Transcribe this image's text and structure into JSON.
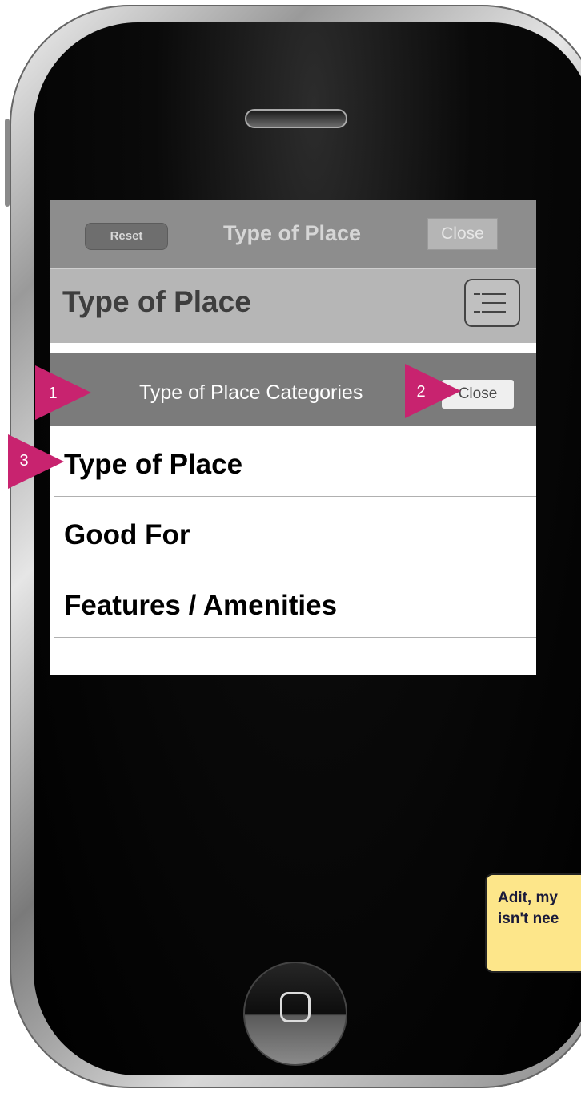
{
  "toolbar": {
    "reset_label": "Reset",
    "title": "Type of Place",
    "close_label": "Close"
  },
  "subheader": {
    "title": "Type of Place",
    "icon": "list-menu-icon"
  },
  "modal": {
    "title": "Type of Place Categories",
    "close_label": "Close",
    "items": [
      {
        "label": "Type of Place"
      },
      {
        "label": "Good For"
      },
      {
        "label": "Features / Amenities"
      }
    ]
  },
  "callouts": [
    {
      "number": "1"
    },
    {
      "number": "2"
    },
    {
      "number": "3"
    }
  ],
  "note": {
    "line1": "Adit, my",
    "line2": "isn't nee"
  },
  "colors": {
    "callout": "#c8236f",
    "note_bg": "#fde68a",
    "topbar": "#8d8d8d",
    "modal_header": "#7b7b7b"
  }
}
